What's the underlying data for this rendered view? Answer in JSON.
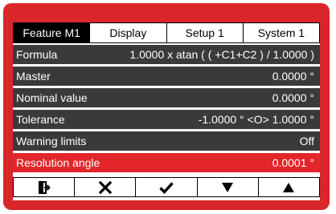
{
  "tabs": [
    {
      "label": "Feature  M1",
      "active": true
    },
    {
      "label": "Display",
      "active": false
    },
    {
      "label": "Setup 1",
      "active": false
    },
    {
      "label": "System 1",
      "active": false
    }
  ],
  "rows": [
    {
      "label": "Formula",
      "value": "1.0000 x atan ( ( +C1+C2 ) / 1.0000 )"
    },
    {
      "label": "Master",
      "value": "0.0000 °"
    },
    {
      "label": "Nominal value",
      "value": "0.0000 °"
    },
    {
      "label": "Tolerance",
      "value": "-1.0000 ° <O> 1.0000 °"
    },
    {
      "label": "Warning limits",
      "value": "Off"
    },
    {
      "label": "Resolution angle",
      "value": "0.0001 °",
      "selected": true
    }
  ],
  "bottom_buttons": [
    {
      "icon": "exit-icon"
    },
    {
      "icon": "cancel-x-icon"
    },
    {
      "icon": "checkmark-icon"
    },
    {
      "icon": "arrow-down-icon"
    },
    {
      "icon": "arrow-up-icon"
    }
  ],
  "colors": {
    "frame": "#d8262b",
    "row": "#3a3a3a",
    "selected_row": "#e3262a"
  }
}
